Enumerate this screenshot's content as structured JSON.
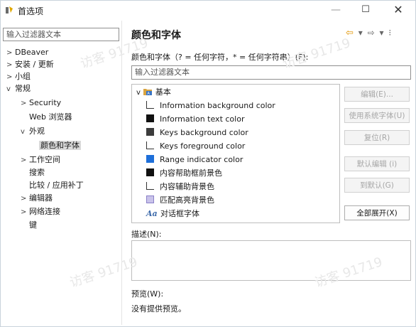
{
  "window": {
    "title": "首选项",
    "controls": [
      "—",
      "☐",
      "✕"
    ]
  },
  "left": {
    "filter_placeholder": "输入过滤器文本",
    "tree": [
      {
        "label": "DBeaver",
        "toggle": ">"
      },
      {
        "label": "安装 / 更新",
        "toggle": ">"
      },
      {
        "label": "小组",
        "toggle": ">"
      },
      {
        "label": "常规",
        "toggle": "v"
      },
      {
        "label": "Security",
        "toggle": ">"
      },
      {
        "label": "Web 浏览器",
        "toggle": ""
      },
      {
        "label": "外观",
        "toggle": "v"
      },
      {
        "label": "颜色和字体",
        "toggle": ""
      },
      {
        "label": "工作空间",
        "toggle": ">"
      },
      {
        "label": "搜索",
        "toggle": ""
      },
      {
        "label": "比较 / 应用补丁",
        "toggle": ""
      },
      {
        "label": "编辑器",
        "toggle": ">"
      },
      {
        "label": "网络连接",
        "toggle": ">"
      },
      {
        "label": "键",
        "toggle": ""
      }
    ]
  },
  "right": {
    "title": "颜色和字体",
    "description": "颜色和字体（? = 任何字符，* = 任何字符串）(F):",
    "filter_placeholder": "输入过滤器文本",
    "group_label": "基本",
    "items": [
      {
        "label": "Information background color",
        "swatch": "open"
      },
      {
        "label": "Information text color",
        "swatch": "#111111"
      },
      {
        "label": "Keys background color",
        "swatch": "#3c3c3c"
      },
      {
        "label": "Keys foreground color",
        "swatch": "open"
      },
      {
        "label": "Range indicator color",
        "swatch": "#1e6fd9"
      },
      {
        "label": "内容帮助框前景色",
        "swatch": "#111111"
      },
      {
        "label": "内容辅助背景色",
        "swatch": "open"
      },
      {
        "label": "匹配高亮背景色",
        "swatch": "#c9c3ea"
      },
      {
        "label": "对话框字体",
        "swatch": "font"
      }
    ],
    "font_icon_text": "Aa",
    "buttons": {
      "edit": "编辑(E)...",
      "use_system_font": "使用系统字体(U)",
      "reset": "复位(R)",
      "edit_default": "默认编辑 (i)",
      "goto_default": "到默认(G)",
      "expand_all": "全部展开(X)"
    },
    "desc_label": "描述(N):",
    "preview_label": "预览(W):",
    "preview_text": "没有提供预览。"
  },
  "watermark": "访客 91719",
  "colors": {
    "accent_back": "#e29400",
    "selected_bg": "#d9d9d9"
  }
}
